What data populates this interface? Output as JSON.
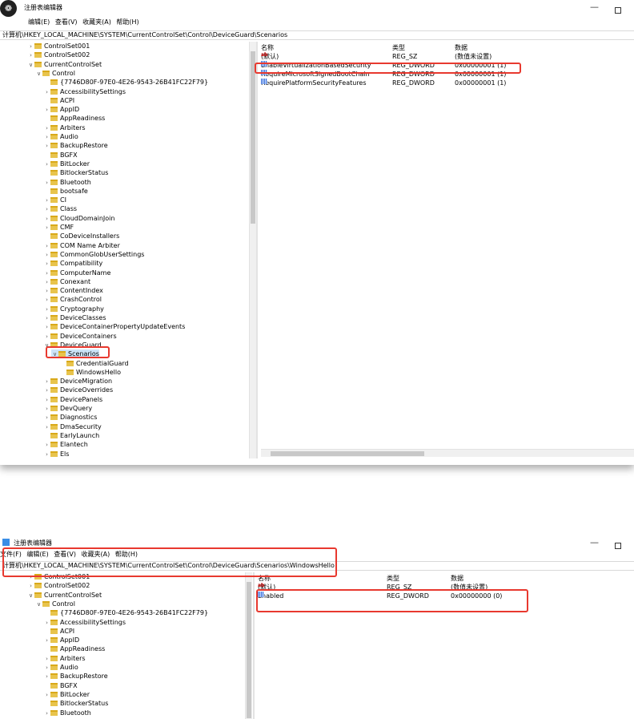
{
  "window1": {
    "title": "注册表编辑器",
    "menu": [
      "编辑(E)",
      "查看(V)",
      "收藏夹(A)",
      "帮助(H)"
    ],
    "address": "计算机\\HKEY_LOCAL_MACHINE\\SYSTEM\\CurrentControlSet\\Control\\DeviceGuard\\Scenarios",
    "tree": [
      {
        "label": "ControlSet001",
        "chev": ">"
      },
      {
        "label": "ControlSet002",
        "chev": ">"
      },
      {
        "label": "CurrentControlSet",
        "chev": "v"
      },
      {
        "label": "Control",
        "chev": "v"
      },
      {
        "label": "{7746D80F-97E0-4E26-9543-26B41FC22F79}",
        "chev": ""
      },
      {
        "label": "AccessibilitySettings",
        "chev": ">"
      },
      {
        "label": "ACPI",
        "chev": ""
      },
      {
        "label": "AppID",
        "chev": ">"
      },
      {
        "label": "AppReadiness",
        "chev": ""
      },
      {
        "label": "Arbiters",
        "chev": ">"
      },
      {
        "label": "Audio",
        "chev": ">"
      },
      {
        "label": "BackupRestore",
        "chev": ">"
      },
      {
        "label": "BGFX",
        "chev": ""
      },
      {
        "label": "BitLocker",
        "chev": ">"
      },
      {
        "label": "BitlockerStatus",
        "chev": ""
      },
      {
        "label": "Bluetooth",
        "chev": ">"
      },
      {
        "label": "bootsafe",
        "chev": ""
      },
      {
        "label": "CI",
        "chev": ">"
      },
      {
        "label": "Class",
        "chev": ">"
      },
      {
        "label": "CloudDomainJoin",
        "chev": ">"
      },
      {
        "label": "CMF",
        "chev": ">"
      },
      {
        "label": "CoDeviceInstallers",
        "chev": ""
      },
      {
        "label": "COM Name Arbiter",
        "chev": ">"
      },
      {
        "label": "CommonGlobUserSettings",
        "chev": ">"
      },
      {
        "label": "Compatibility",
        "chev": ">"
      },
      {
        "label": "ComputerName",
        "chev": ">"
      },
      {
        "label": "Conexant",
        "chev": ">"
      },
      {
        "label": "ContentIndex",
        "chev": ">"
      },
      {
        "label": "CrashControl",
        "chev": ">"
      },
      {
        "label": "Cryptography",
        "chev": ">"
      },
      {
        "label": "DeviceClasses",
        "chev": ">"
      },
      {
        "label": "DeviceContainerPropertyUpdateEvents",
        "chev": ">"
      },
      {
        "label": "DeviceContainers",
        "chev": ">"
      },
      {
        "label": "DeviceGuard",
        "chev": "v"
      },
      {
        "label": "Scenarios",
        "chev": "v"
      },
      {
        "label": "CredentialGuard",
        "chev": ""
      },
      {
        "label": "WindowsHello",
        "chev": ""
      },
      {
        "label": "DeviceMigration",
        "chev": ">"
      },
      {
        "label": "DeviceOverrides",
        "chev": ">"
      },
      {
        "label": "DevicePanels",
        "chev": ">"
      },
      {
        "label": "DevQuery",
        "chev": ">"
      },
      {
        "label": "Diagnostics",
        "chev": ">"
      },
      {
        "label": "DmaSecurity",
        "chev": ">"
      },
      {
        "label": "EarlyLaunch",
        "chev": ""
      },
      {
        "label": "Elantech",
        "chev": ">"
      },
      {
        "label": "Els",
        "chev": ">"
      }
    ],
    "columns": {
      "name": "名称",
      "type": "类型",
      "data": "数据"
    },
    "values": [
      {
        "icon": "string-value-icon",
        "name": "(默认)",
        "type": "REG_SZ",
        "data": "(数值未设置)"
      },
      {
        "icon": "dword-value-icon",
        "name": "EnableVirtualizationBasedSecurity",
        "type": "REG_DWORD",
        "data": "0x00000001 (1)"
      },
      {
        "icon": "dword-value-icon",
        "name": "RequireMicrosoftSignedBootChain",
        "type": "REG_DWORD",
        "data": "0x00000001 (1)"
      },
      {
        "icon": "dword-value-icon",
        "name": "RequirePlatformSecurityFeatures",
        "type": "REG_DWORD",
        "data": "0x00000001 (1)"
      }
    ]
  },
  "window2": {
    "title": "注册表编辑器",
    "menu": [
      "文件(F)",
      "编辑(E)",
      "查看(V)",
      "收藏夹(A)",
      "帮助(H)"
    ],
    "address": "计算机\\HKEY_LOCAL_MACHINE\\SYSTEM\\CurrentControlSet\\Control\\DeviceGuard\\Scenarios\\WindowsHello",
    "tree": [
      {
        "label": "ControlSet001",
        "chev": ">"
      },
      {
        "label": "ControlSet002",
        "chev": ">"
      },
      {
        "label": "CurrentControlSet",
        "chev": "v"
      },
      {
        "label": "Control",
        "chev": "v"
      },
      {
        "label": "{7746D80F-97E0-4E26-9543-26B41FC22F79}",
        "chev": ""
      },
      {
        "label": "AccessibilitySettings",
        "chev": ">"
      },
      {
        "label": "ACPI",
        "chev": ""
      },
      {
        "label": "AppID",
        "chev": ">"
      },
      {
        "label": "AppReadiness",
        "chev": ""
      },
      {
        "label": "Arbiters",
        "chev": ">"
      },
      {
        "label": "Audio",
        "chev": ">"
      },
      {
        "label": "BackupRestore",
        "chev": ">"
      },
      {
        "label": "BGFX",
        "chev": ""
      },
      {
        "label": "BitLocker",
        "chev": ">"
      },
      {
        "label": "BitlockerStatus",
        "chev": ""
      },
      {
        "label": "Bluetooth",
        "chev": ">"
      }
    ],
    "columns": {
      "name": "名称",
      "type": "类型",
      "data": "数据"
    },
    "values": [
      {
        "icon": "string-value-icon",
        "name": "(默认)",
        "type": "REG_SZ",
        "data": "(数值未设置)"
      },
      {
        "icon": "dword-value-icon",
        "name": "Enabled",
        "type": "REG_DWORD",
        "data": "0x00000000 (0)"
      }
    ]
  },
  "colors": {
    "highlight": "#e8392f",
    "folder": "#e8c44d",
    "selection": "#cce4f7"
  }
}
